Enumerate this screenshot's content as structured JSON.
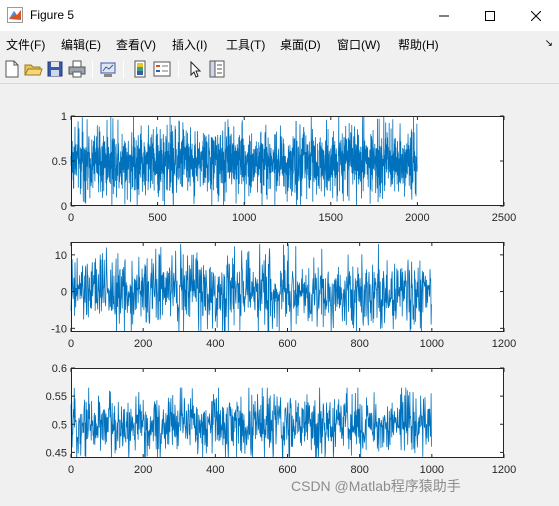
{
  "window": {
    "title": "Figure 5",
    "controls": [
      "minimize",
      "maximize",
      "close"
    ]
  },
  "menu": {
    "items": [
      {
        "label": "文件(F)"
      },
      {
        "label": "编辑(E)"
      },
      {
        "label": "查看(V)"
      },
      {
        "label": "插入(I)"
      },
      {
        "label": "工具(T)"
      },
      {
        "label": "桌面(D)"
      },
      {
        "label": "窗口(W)"
      },
      {
        "label": "帮助(H)"
      }
    ],
    "pin_glyph": "↘"
  },
  "toolbar": {
    "buttons": [
      {
        "icon": "new-figure-icon"
      },
      {
        "icon": "open-file-icon"
      },
      {
        "icon": "save-icon"
      },
      {
        "icon": "print-icon"
      },
      {
        "icon": "link-plot-icon"
      },
      {
        "icon": "colorbar-icon"
      },
      {
        "icon": "legend-icon"
      },
      {
        "icon": "edit-plot-icon"
      },
      {
        "icon": "property-inspector-icon"
      }
    ]
  },
  "chart_data": [
    {
      "type": "line",
      "series": [
        {
          "kind": "noise",
          "n": 2000,
          "low": 0,
          "high": 1,
          "center": 0.5,
          "spread": 0.17,
          "color": "#0072bd"
        }
      ],
      "xlim": [
        0,
        2500
      ],
      "ylim": [
        0,
        1
      ],
      "xticks": [
        0,
        500,
        1000,
        1500,
        2000,
        2500
      ],
      "yticks": [
        0,
        0.5,
        1
      ],
      "xtick_labels": [
        "0",
        "500",
        "1000",
        "1500",
        "2000",
        "2500"
      ],
      "ytick_labels": [
        "0",
        "0.5",
        "1"
      ],
      "title": "",
      "xlabel": "",
      "ylabel": "",
      "grid": false
    },
    {
      "type": "line",
      "series": [
        {
          "kind": "noise",
          "n": 1000,
          "low": -11,
          "high": 13,
          "center": 0,
          "spread": 4.5,
          "color": "#0072bd"
        }
      ],
      "xlim": [
        0,
        1200
      ],
      "ylim": [
        -11,
        13.5
      ],
      "xticks": [
        0,
        200,
        400,
        600,
        800,
        1000,
        1200
      ],
      "yticks": [
        -10,
        0,
        10
      ],
      "xtick_labels": [
        "0",
        "200",
        "400",
        "600",
        "800",
        "1000",
        "1200"
      ],
      "ytick_labels": [
        "-10",
        "0",
        "10"
      ],
      "title": "",
      "xlabel": "",
      "ylabel": "",
      "grid": false
    },
    {
      "type": "line",
      "series": [
        {
          "kind": "noise",
          "n": 1000,
          "low": 0.44,
          "high": 0.565,
          "center": 0.5,
          "spread": 0.026,
          "color": "#0072bd"
        }
      ],
      "xlim": [
        0,
        1200
      ],
      "ylim": [
        0.44,
        0.6
      ],
      "xticks": [
        0,
        200,
        400,
        600,
        800,
        1000,
        1200
      ],
      "yticks": [
        0.45,
        0.5,
        0.55,
        0.6
      ],
      "xtick_labels": [
        "0",
        "200",
        "400",
        "600",
        "800",
        "1000",
        "1200"
      ],
      "ytick_labels": [
        "0.45",
        "0.5",
        "0.55",
        "0.6"
      ],
      "title": "",
      "xlabel": "",
      "ylabel": "",
      "grid": false
    }
  ],
  "watermark": "CSDN @Matlab程序猿助手"
}
